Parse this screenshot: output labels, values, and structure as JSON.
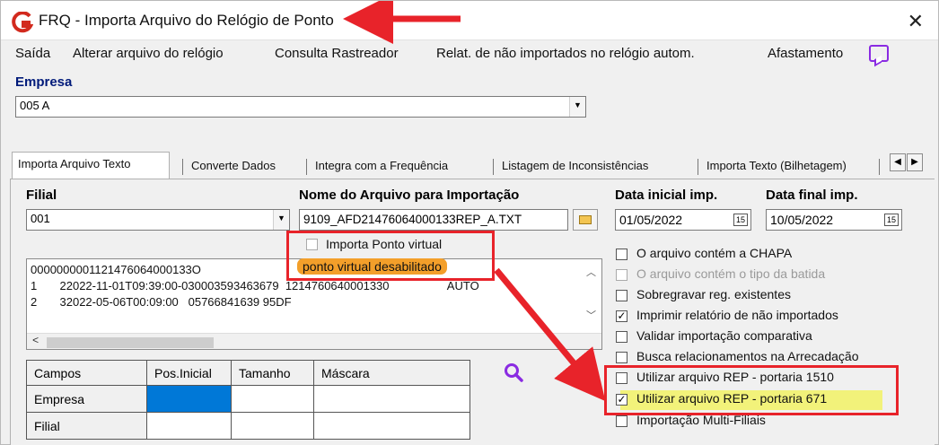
{
  "window": {
    "title": "FRQ - Importa Arquivo do Relógio de Ponto",
    "close_symbol": "✕"
  },
  "menu": {
    "items": [
      "Saída",
      "Alterar arquivo do relógio",
      "Consulta Rastreador",
      "Relat. de não importados no relógio autom.",
      "Afastamento"
    ],
    "afastamento_icon": "chat-icon"
  },
  "empresa": {
    "label": "Empresa",
    "value": "005 A"
  },
  "tabs": [
    {
      "label": "Importa Arquivo Texto",
      "active": true
    },
    {
      "label": "Converte Dados"
    },
    {
      "label": "Integra com a Frequência"
    },
    {
      "label": "Listagem de Inconsistências"
    },
    {
      "label": "Importa Texto (Bilhetagem)"
    }
  ],
  "filial": {
    "label": "Filial",
    "value": "001"
  },
  "arquivo": {
    "label": "Nome do Arquivo para Importação",
    "value": "9109_AFD21476064000133REP_A.TXT"
  },
  "data_inicial": {
    "label": "Data inicial imp.",
    "value": "01/05/2022",
    "calendar_glyph": "15"
  },
  "data_final": {
    "label": "Data final imp.",
    "value": "10/05/2022",
    "calendar_glyph": "15"
  },
  "ponto_virtual": {
    "label": "Importa Ponto virtual",
    "checked": false,
    "tooltip": "ponto virtual desabilitado"
  },
  "preview": {
    "lines": [
      "0000000001121476064000133O",
      "1       22022-11-01T09:39:00-030003593463679  1214760640001330                  AUTO",
      "2       32022-05-06T00:09:00   05766841639 95DF"
    ]
  },
  "options": [
    {
      "label": "O arquivo contém a CHAPA",
      "checked": false,
      "disabled": false
    },
    {
      "label": "O arquivo contém o tipo da batida",
      "checked": false,
      "disabled": true
    },
    {
      "label": "Sobregravar reg. existentes",
      "checked": false,
      "disabled": false
    },
    {
      "label": "Imprimir relatório de não importados",
      "checked": true,
      "disabled": false
    },
    {
      "label": "Validar importação comparativa",
      "checked": false,
      "disabled": false
    },
    {
      "label": "Busca relacionamentos na Arrecadação",
      "checked": false,
      "disabled": false
    },
    {
      "label": "Utilizar arquivo REP - portaria 1510",
      "checked": false,
      "disabled": false
    },
    {
      "label": "Utilizar arquivo REP - portaria 671",
      "checked": true,
      "disabled": false
    },
    {
      "label": "Importação Multi-Filiais",
      "checked": false,
      "disabled": false
    }
  ],
  "grid": {
    "headers": [
      "Campos",
      "Pos.Inicial",
      "Tamanho",
      "Máscara"
    ],
    "rows": [
      "Empresa",
      "Filial"
    ]
  },
  "colors": {
    "annotation_red": "#e8232a",
    "label_blue": "#001a7a",
    "tooltip_orange": "#f39f2a",
    "highlight_yellow": "#f2f27a",
    "selection_blue": "#0078d7",
    "search_purple": "#8a2be2"
  }
}
